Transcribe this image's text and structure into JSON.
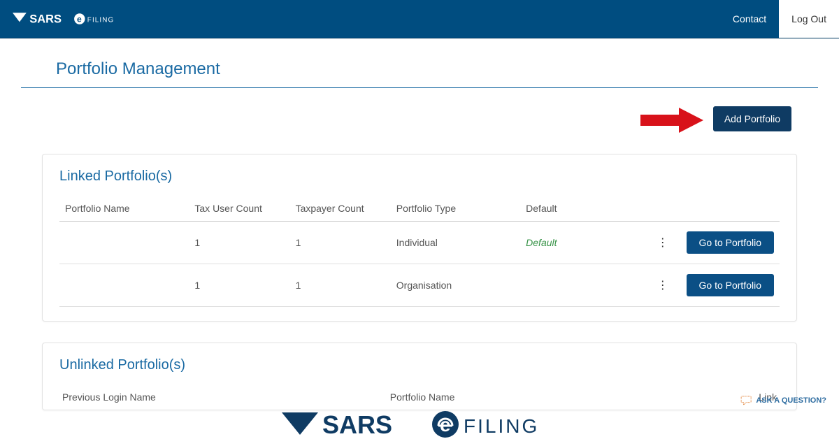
{
  "header": {
    "brand_main": "SARS",
    "brand_sub": "FILING",
    "contact": "Contact",
    "logout": "Log Out"
  },
  "page": {
    "title": "Portfolio Management",
    "add_portfolio": "Add Portfolio"
  },
  "linked": {
    "heading": "Linked Portfolio(s)",
    "columns": {
      "name": "Portfolio Name",
      "tax_user_count": "Tax User Count",
      "taxpayer_count": "Taxpayer Count",
      "type": "Portfolio Type",
      "default": "Default"
    },
    "rows": [
      {
        "name": "",
        "tax_user_count": "1",
        "taxpayer_count": "1",
        "type": "Individual",
        "default": "Default",
        "action": "Go to Portfolio"
      },
      {
        "name": "",
        "tax_user_count": "1",
        "taxpayer_count": "1",
        "type": "Organisation",
        "default": "",
        "action": "Go to Portfolio"
      }
    ]
  },
  "unlinked": {
    "heading": "Unlinked Portfolio(s)",
    "columns": {
      "prev_login": "Previous Login Name",
      "portfolio_name": "Portfolio Name",
      "link": "Link"
    }
  },
  "ask": "ASK A QUESTION?",
  "footer": {
    "brand_main": "SARS",
    "brand_sub": "FILING"
  }
}
